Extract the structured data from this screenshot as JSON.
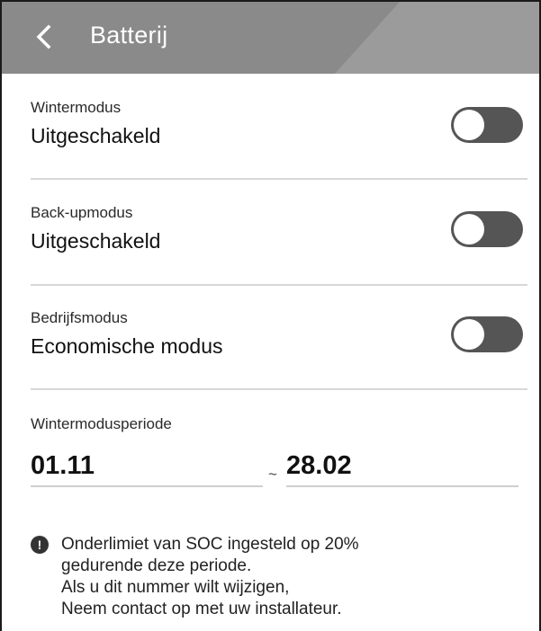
{
  "header": {
    "title": "Batterij",
    "back_icon": "chevron-left-icon"
  },
  "settings": [
    {
      "label": "Wintermodus",
      "value": "Uitgeschakeld",
      "toggle_on": false
    },
    {
      "label": "Back-upmodus",
      "value": "Uitgeschakeld",
      "toggle_on": false
    },
    {
      "label": "Bedrijfsmodus",
      "value": "Economische modus",
      "toggle_on": false
    }
  ],
  "period": {
    "label": "Wintermodusperiode",
    "start": "01.11",
    "separator": "~",
    "end": "28.02"
  },
  "info": {
    "icon": "exclamation-circle-icon",
    "lines": [
      "Onderlimiet van SOC ingesteld op 20%",
      "gedurende deze periode.",
      "Als u dit nummer wilt wijzigen,",
      "Neem contact op met uw installateur."
    ]
  },
  "colors": {
    "header_bg": "#8a8a8a",
    "toggle_off": "#555555",
    "divider": "#d7d7d7"
  }
}
